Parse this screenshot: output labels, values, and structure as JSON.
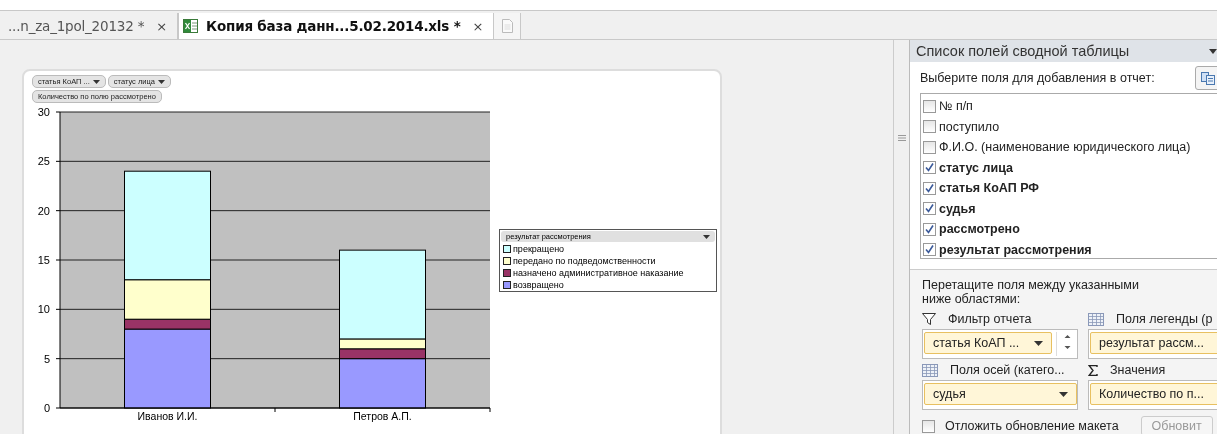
{
  "tabs": [
    {
      "label": "...n_za_1pol_20132 *",
      "selected": false,
      "excel_icon": false,
      "close": "×"
    },
    {
      "label": "Копия база данн...5.02.2014.xls *",
      "selected": true,
      "excel_icon": true,
      "close": "×"
    }
  ],
  "chart": {
    "field_buttons": [
      {
        "label": "статья КоАП ...",
        "dropdown": true
      },
      {
        "label": "статус лица",
        "dropdown": true
      }
    ],
    "value_button": "Количество по полю рассмотрено",
    "legend_title": "результат рассмотрения",
    "chart_data": {
      "type": "bar",
      "stacked": true,
      "grid": true,
      "categories": [
        "Иванов И.И.",
        "Петров А.П."
      ],
      "ylim": [
        0,
        30
      ],
      "yticks": [
        0,
        5,
        10,
        15,
        20,
        25,
        30
      ],
      "series": [
        {
          "name": "прекращено",
          "color": "#ccffff",
          "values": [
            11,
            9
          ]
        },
        {
          "name": "передано по подведомственности",
          "color": "#ffffcc",
          "values": [
            4,
            1
          ]
        },
        {
          "name": "назначено административное наказание",
          "color": "#993366",
          "values": [
            1,
            1
          ]
        },
        {
          "name": "возвращено",
          "color": "#9999ff",
          "values": [
            8,
            5
          ]
        }
      ]
    }
  },
  "panel": {
    "title": "Список полей сводной таблицы",
    "choose_label": "Выберите поля для добавления в отчет:",
    "fields": [
      {
        "label": "№ п/п",
        "checked": false
      },
      {
        "label": "поступило",
        "checked": false
      },
      {
        "label": "Ф.И.О. (наименование юридического лица)",
        "checked": false
      },
      {
        "label": "статус лица",
        "checked": true
      },
      {
        "label": "статья КоАП РФ",
        "checked": true
      },
      {
        "label": "судья",
        "checked": true
      },
      {
        "label": "рассмотрено",
        "checked": true
      },
      {
        "label": "результат рассмотрения",
        "checked": true
      }
    ],
    "drag_label": "Перетащите поля между указанными ниже областями:",
    "areas": [
      {
        "kind": "filter",
        "label": "Фильтр отчета",
        "items": [
          {
            "label": "статья КоАП ...",
            "dropdown": true
          }
        ]
      },
      {
        "kind": "legend",
        "label": "Поля легенды (р",
        "items": [
          {
            "label": "результат рассм...",
            "dropdown": false
          }
        ]
      },
      {
        "kind": "axis",
        "label": "Поля осей (катего...",
        "items": [
          {
            "label": "судья",
            "dropdown": true
          }
        ]
      },
      {
        "kind": "values",
        "label": "Значения",
        "items": [
          {
            "label": "Количество по п...",
            "dropdown": false
          }
        ]
      }
    ],
    "defer": {
      "label": "Отложить обновление макета",
      "checked": false
    },
    "update_button": "Обновит"
  }
}
